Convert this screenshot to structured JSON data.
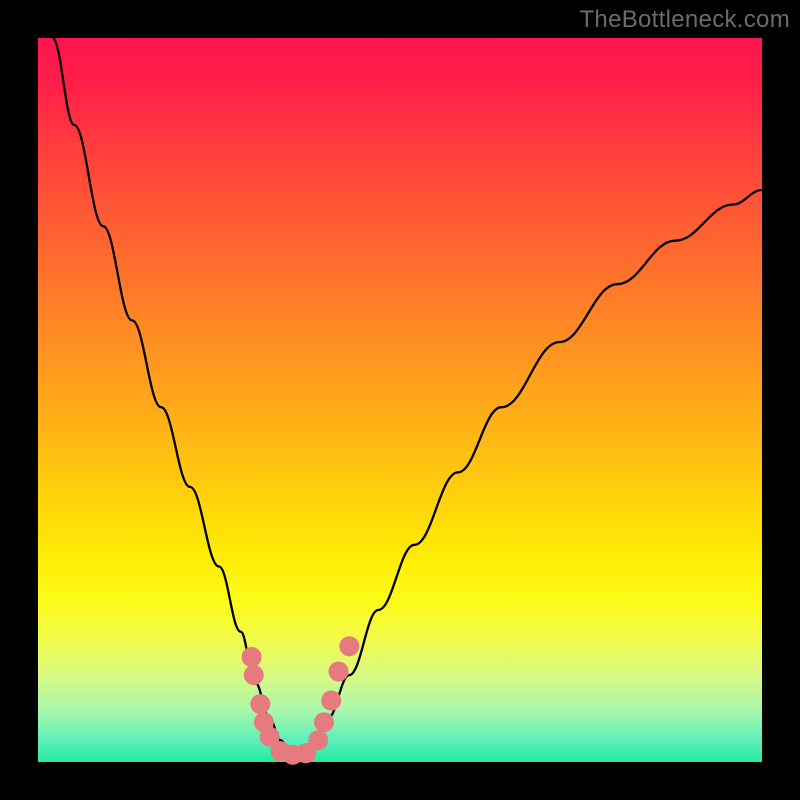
{
  "watermark": "TheBottleneck.com",
  "chart_data": {
    "type": "line",
    "title": "",
    "xlabel": "",
    "ylabel": "",
    "xlim": [
      0,
      1
    ],
    "ylim": [
      0,
      1
    ],
    "series": [
      {
        "name": "bottleneck-curve",
        "x": [
          0.02,
          0.05,
          0.09,
          0.13,
          0.17,
          0.21,
          0.25,
          0.28,
          0.3,
          0.32,
          0.335,
          0.35,
          0.365,
          0.38,
          0.4,
          0.43,
          0.47,
          0.52,
          0.58,
          0.64,
          0.72,
          0.8,
          0.88,
          0.96,
          1.0
        ],
        "y": [
          1.0,
          0.88,
          0.74,
          0.61,
          0.49,
          0.38,
          0.27,
          0.18,
          0.11,
          0.06,
          0.03,
          0.01,
          0.01,
          0.03,
          0.06,
          0.12,
          0.21,
          0.3,
          0.4,
          0.49,
          0.58,
          0.66,
          0.72,
          0.77,
          0.79
        ]
      }
    ],
    "markers": [
      {
        "x": 0.295,
        "y": 0.145
      },
      {
        "x": 0.298,
        "y": 0.12
      },
      {
        "x": 0.307,
        "y": 0.08
      },
      {
        "x": 0.312,
        "y": 0.055
      },
      {
        "x": 0.32,
        "y": 0.035
      },
      {
        "x": 0.335,
        "y": 0.015
      },
      {
        "x": 0.352,
        "y": 0.01
      },
      {
        "x": 0.37,
        "y": 0.012
      },
      {
        "x": 0.387,
        "y": 0.03
      },
      {
        "x": 0.395,
        "y": 0.055
      },
      {
        "x": 0.405,
        "y": 0.085
      },
      {
        "x": 0.415,
        "y": 0.125
      },
      {
        "x": 0.43,
        "y": 0.16
      }
    ],
    "colors": {
      "curve": "#000000",
      "marker": "#e77a7e"
    }
  }
}
